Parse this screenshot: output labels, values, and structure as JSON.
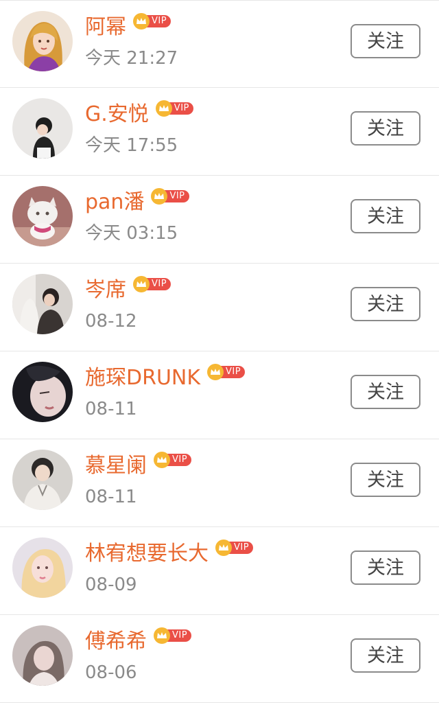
{
  "follow_label": "关注",
  "vip_label": "VIP",
  "colors": {
    "name": "#e8692f",
    "time": "#8a8a8a",
    "vip_badge": "#ea4f47",
    "crown": "#f6b733",
    "divider": "#e6e6e6"
  },
  "users": [
    {
      "name": "阿幂",
      "time": "今天 21:27",
      "avatar": "avatar-cartoon-girl"
    },
    {
      "name": "G.安悦",
      "time": "今天 17:55",
      "avatar": "avatar-girl-photo"
    },
    {
      "name": "pan潘",
      "time": "今天 03:15",
      "avatar": "avatar-white-cat"
    },
    {
      "name": "岑席",
      "time": "08-12",
      "avatar": "avatar-couple-photo"
    },
    {
      "name": "施琛DRUNK",
      "time": "08-11",
      "avatar": "avatar-face-closeup"
    },
    {
      "name": "慕星阑",
      "time": "08-11",
      "avatar": "avatar-boy-photo"
    },
    {
      "name": "林宥想要长大",
      "time": "08-09",
      "avatar": "avatar-blonde-girl"
    },
    {
      "name": "傅希希",
      "time": "08-06",
      "avatar": "avatar-girl-soft"
    }
  ]
}
